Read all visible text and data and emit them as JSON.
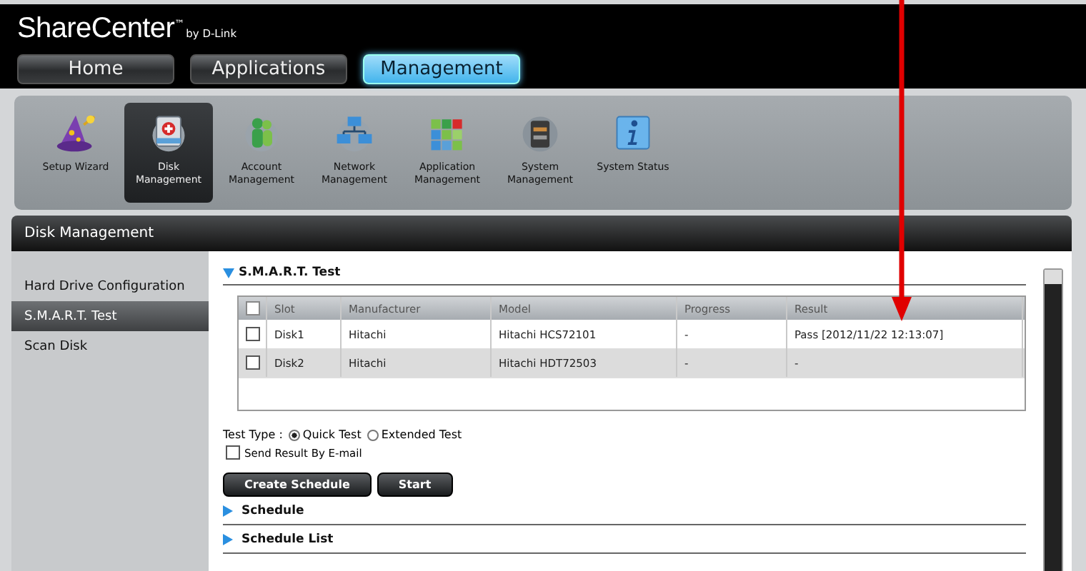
{
  "logo": {
    "name": "ShareCenter",
    "tm": "™",
    "by": "by D-Link"
  },
  "tabs": [
    {
      "label": "Home",
      "selected": false
    },
    {
      "label": "Applications",
      "selected": false
    },
    {
      "label": "Management",
      "selected": true
    }
  ],
  "toolbar": [
    {
      "label": "Setup Wizard",
      "selected": false
    },
    {
      "label": "Disk Management",
      "selected": true
    },
    {
      "label": "Account Management",
      "selected": false
    },
    {
      "label": "Network Management",
      "selected": false
    },
    {
      "label": "Application Management",
      "selected": false
    },
    {
      "label": "System Management",
      "selected": false
    },
    {
      "label": "System Status",
      "selected": false
    }
  ],
  "panel_title": "Disk Management",
  "sidebar": [
    {
      "label": "Hard Drive Configuration",
      "selected": false
    },
    {
      "label": "S.M.A.R.T. Test",
      "selected": true
    },
    {
      "label": "Scan Disk",
      "selected": false
    }
  ],
  "section": {
    "title": "S.M.A.R.T. Test",
    "expanded": true
  },
  "table": {
    "header_checked": false,
    "columns": [
      "Slot",
      "Manufacturer",
      "Model",
      "Progress",
      "Result"
    ],
    "rows": [
      {
        "checked": false,
        "cells": [
          "Disk1",
          "Hitachi",
          "Hitachi HCS72101",
          "-",
          "Pass [2012/11/22 12:13:07]"
        ]
      },
      {
        "checked": false,
        "cells": [
          "Disk2",
          "Hitachi",
          "Hitachi HDT72503",
          "-",
          "-"
        ]
      }
    ]
  },
  "test_type": {
    "label": "Test Type :",
    "options": [
      {
        "label": "Quick Test",
        "selected": true
      },
      {
        "label": "Extended Test",
        "selected": false
      }
    ]
  },
  "email": {
    "label": "Send Result By E-mail",
    "checked": false
  },
  "buttons": [
    "Create Schedule",
    "Start"
  ],
  "collapsed_sections": [
    {
      "title": "Schedule",
      "expanded": false
    },
    {
      "title": "Schedule List",
      "expanded": false
    }
  ]
}
